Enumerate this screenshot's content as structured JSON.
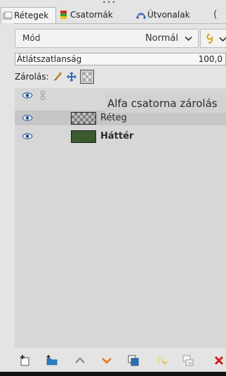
{
  "tabs": [
    {
      "label": "Rétegek",
      "icon": "layers-icon",
      "active": true
    },
    {
      "label": "Csatornák",
      "icon": "channels-icon",
      "active": false
    },
    {
      "label": "Útvonalak",
      "icon": "paths-icon",
      "active": false
    }
  ],
  "mode": {
    "label": "Mód",
    "value": "Normál"
  },
  "opacity": {
    "label": "Átlátszatlanság",
    "value": "100,0"
  },
  "lock": {
    "label": "Zárolás:",
    "buttons": [
      "lock-pixels-icon",
      "lock-position-icon",
      "lock-alpha-icon"
    ]
  },
  "tooltip": "Alfa csatorna zárolás",
  "layers": [
    {
      "name": "Réteg",
      "thumb": "checker",
      "bold": false,
      "selected": true
    },
    {
      "name": "Háttér",
      "thumb": "green",
      "bold": true,
      "selected": false
    }
  ],
  "toolbar": [
    "new-layer-icon",
    "new-group-icon",
    "raise-layer-icon",
    "lower-layer-icon",
    "duplicate-layer-icon",
    "anchor-layer-icon",
    "merge-layer-icon",
    "delete-layer-icon"
  ],
  "colors": {
    "background": "#e4e4e4",
    "list_background": "#d7d7d7",
    "selected_row": "#c6c6c6",
    "layer_green": "#3d5a2f",
    "accent_blue": "#1e6db3",
    "delete_red": "#d01818",
    "arrow_orange": "#e0741a"
  }
}
